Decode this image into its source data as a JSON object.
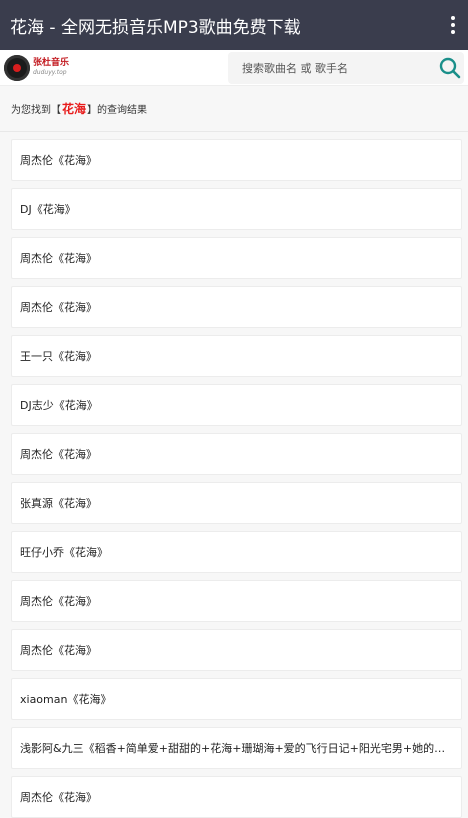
{
  "topbar": {
    "title": "花海 - 全网无损音乐MP3歌曲免费下载"
  },
  "header": {
    "logo_cn": "张杜音乐",
    "logo_en": "duduyy.top",
    "search_placeholder": "搜索歌曲名 或 歌手名"
  },
  "results": {
    "prefix": "为您找到【",
    "keyword": "花海",
    "suffix": "】的查询结果"
  },
  "songs": [
    "周杰伦《花海》",
    "DJ《花海》",
    "周杰伦《花海》",
    "周杰伦《花海》",
    "王一只《花海》",
    "DJ志少《花海》",
    "周杰伦《花海》",
    "张真源《花海》",
    "旺仔小乔《花海》",
    "周杰伦《花海》",
    "周杰伦《花海》",
    "xiaoman《花海》",
    "浅影阿&九三《稻香+简单爱+甜甜的+花海+珊瑚海+爱的飞行日记+阳光宅男+她的睫毛...",
    "周杰伦《花海》"
  ]
}
